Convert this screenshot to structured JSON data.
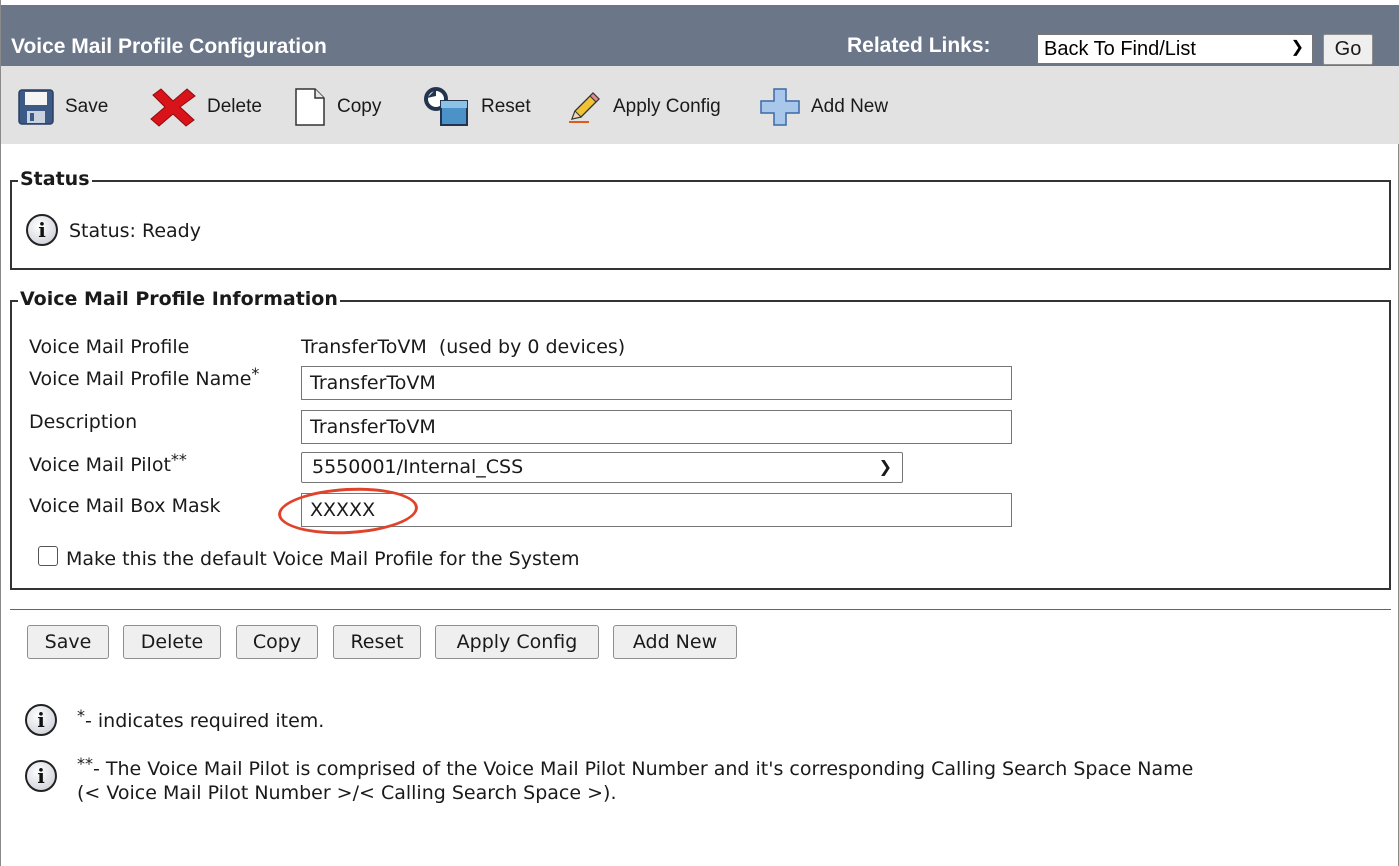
{
  "header": {
    "title": "Voice Mail Profile Configuration",
    "related_links_label": "Related Links:",
    "related_links_selected": "Back To Find/List",
    "go_label": "Go"
  },
  "toolbar": {
    "save": "Save",
    "delete": "Delete",
    "copy": "Copy",
    "reset": "Reset",
    "apply_config": "Apply Config",
    "add_new": "Add New"
  },
  "status": {
    "legend": "Status",
    "text": "Status: Ready"
  },
  "profile": {
    "legend": "Voice Mail Profile Information",
    "profile_label": "Voice Mail Profile",
    "profile_value": "TransferToVM  (used by 0 devices)",
    "name_label": "Voice Mail Profile Name",
    "name_required": "*",
    "name_value": "TransferToVM",
    "description_label": "Description",
    "description_value": "TransferToVM",
    "pilot_label": "Voice Mail Pilot",
    "pilot_required": "**",
    "pilot_value": "5550001/Internal_CSS",
    "mask_label": "Voice Mail Box Mask",
    "mask_value": "XXXXX",
    "default_checkbox_label": "Make this the default Voice Mail Profile for the System",
    "default_checked": false,
    "highlight_color": "#e0432b"
  },
  "bottom_buttons": {
    "save": "Save",
    "delete": "Delete",
    "copy": "Copy",
    "reset": "Reset",
    "apply_config": "Apply Config",
    "add_new": "Add New"
  },
  "footnotes": {
    "required_mark": "*",
    "required_text": "- indicates required item.",
    "pilot_mark": "**",
    "pilot_text_line1": "- The Voice Mail Pilot is comprised of the Voice Mail Pilot Number and it's corresponding Calling Search Space Name",
    "pilot_text_line2": "(< Voice Mail Pilot Number >/< Calling Search Space >)."
  },
  "icons": {
    "info": "i"
  },
  "colors": {
    "header_bg": "#6b7689",
    "toolbar_bg": "#e2e2e2",
    "delete_red": "#d8141a"
  }
}
